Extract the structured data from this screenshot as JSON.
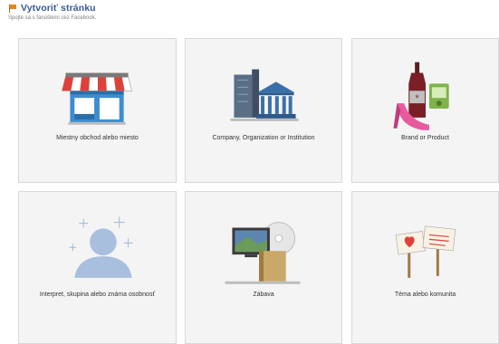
{
  "header": {
    "title": "Vytvoriť stránku",
    "subtitle": "Spojte sa s fanúšikmi cez Facebook.",
    "icon": "flag-icon"
  },
  "categories": [
    {
      "label": "Miestny obchod alebo miesto",
      "icon": "storefront-icon"
    },
    {
      "label": "Company, Organization or Institution",
      "icon": "buildings-icon"
    },
    {
      "label": "Brand or Product",
      "icon": "products-icon"
    },
    {
      "label": "Interpret, skupina alebo známa osobnosť",
      "icon": "person-star-icon"
    },
    {
      "label": "Zábava",
      "icon": "entertainment-icon"
    },
    {
      "label": "Téma alebo komunita",
      "icon": "signs-icon"
    }
  ],
  "colors": {
    "title": "#3b5998",
    "card_bg": "#f4f4f4",
    "card_border": "#d8d8d8",
    "awning_red": "#e0403a",
    "awning_white": "#ffffff"
  }
}
